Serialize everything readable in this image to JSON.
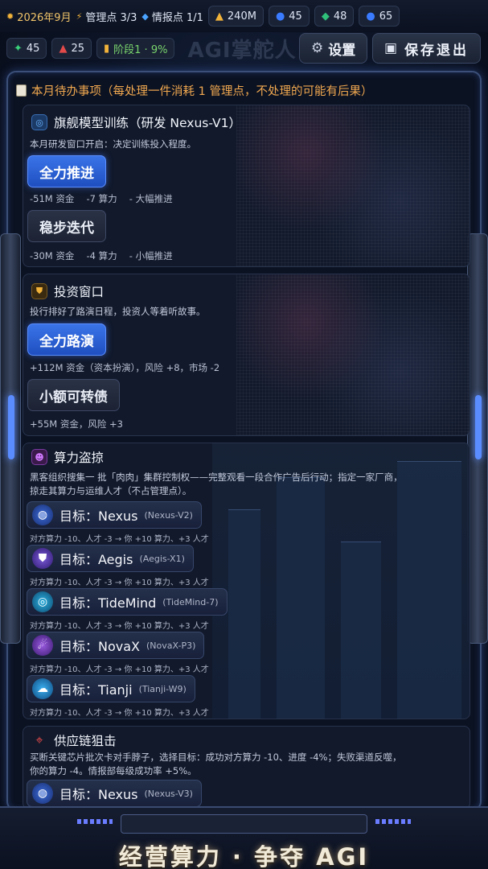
{
  "status": {
    "date": "2026年9月",
    "mgmt_points": "管理点 3/3",
    "intel_points": "情报点 1/1",
    "funds": "240M",
    "compute": "45",
    "talent": "48",
    "data": "65"
  },
  "status2": {
    "v1": "45",
    "v2": "25",
    "phase": "阶段1 · 9%"
  },
  "game_title": "AGI掌舵人",
  "buttons": {
    "settings": "设置",
    "save_exit": "保存退出"
  },
  "notice": "本月待办事项（每处理一件消耗 1 管理点，不处理的可能有后果）",
  "cards": [
    {
      "title": "旗舰模型训练（研发 Nexus-V1）",
      "desc": "本月研发窗口开启：决定训练投入程度。",
      "choices": [
        {
          "label": "全力推进",
          "effect": "-51M 资金 　-7 算力 　- 大幅推进"
        },
        {
          "label": "稳步迭代",
          "effect": "-30M 资金 　-4 算力 　- 小幅推进"
        }
      ]
    },
    {
      "title": "投资窗口",
      "desc": "投行排好了路演日程，投资人等着听故事。",
      "choices": [
        {
          "label": "全力路演",
          "effect": "+112M 资金（资本扮演），风险 +8，市场 -2"
        },
        {
          "label": "小额可转债",
          "effect": "+55M 资金，风险 +3"
        }
      ]
    },
    {
      "title": "算力盗掠",
      "desc1": "黑客组织搜集一 批「肉肉」集群控制权——完整观看一段合作广告后行动；指定一家厂商，",
      "desc2": "掠走其算力与运维人才（不占管理点）。",
      "targets": [
        {
          "label": "目标：Nexus",
          "model": "(Nexus-V2)",
          "effect": "对方算力 -10、人才 -3 → 你 +10 算力、+3 人才"
        },
        {
          "label": "目标：Aegis",
          "model": "(Aegis-X1)",
          "effect": "对方算力 -10、人才 -3 → 你 +10 算力、+3 人才"
        },
        {
          "label": "目标：TideMind",
          "model": "(TideMind-7)",
          "effect": "对方算力 -10、人才 -3 → 你 +10 算力、+3 人才"
        },
        {
          "label": "目标：NovaX",
          "model": "(NovaX-P3)",
          "effect": "对方算力 -10、人才 -3 → 你 +10 算力、+3 人才"
        },
        {
          "label": "目标：Tianji",
          "model": "(Tianji-W9)",
          "effect": "对方算力 -10、人才 -3 → 你 +10 算力、+3 人才"
        }
      ]
    },
    {
      "title": "供应链狙击",
      "desc1": "买断关键芯片批次卡对手脖子，选择目标：成功对方算力 -10、进度 -4%；失败渠道反噬，",
      "desc2": "你的算力 -4。情报部每级成功率 +5%。",
      "targets": [
        {
          "label": "目标：Nexus",
          "model": "(Nexus-V3)"
        }
      ]
    }
  ],
  "banner": "经营算力 · 争夺 AGI"
}
